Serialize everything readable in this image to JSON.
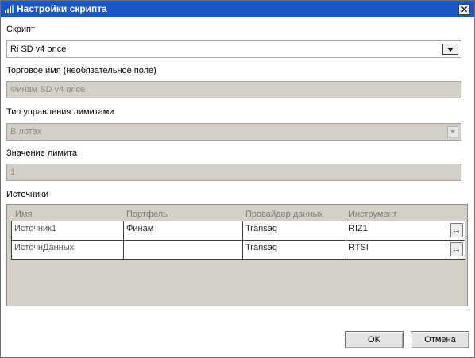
{
  "window": {
    "title": "Настройки скрипта",
    "close_label": "✕",
    "title_bar_color": "#1c56c6"
  },
  "script": {
    "label": "Скрипт",
    "value": "Ri SD v4 once"
  },
  "trade_name": {
    "label": "Торговое имя (необязательное поле)",
    "value": "Финам SD v4 once"
  },
  "limit_type": {
    "label": "Тип управления лимитами",
    "value": "В лотах"
  },
  "limit_value": {
    "label": "Значение лимита",
    "value": "1"
  },
  "sources": {
    "label": "Источники",
    "columns": [
      "Имя",
      "Портфель",
      "Провайдер данных",
      "Инструмент"
    ],
    "rows": [
      {
        "name": "Источник1",
        "portfolio": "Финам",
        "provider": "Transaq",
        "instrument": "RIZ1",
        "more": "..."
      },
      {
        "name": "ИсточнДанных",
        "portfolio": "",
        "provider": "Transaq",
        "instrument": "RTSI",
        "more": "..."
      }
    ]
  },
  "buttons": {
    "ok": "OK",
    "cancel": "Отмена"
  }
}
